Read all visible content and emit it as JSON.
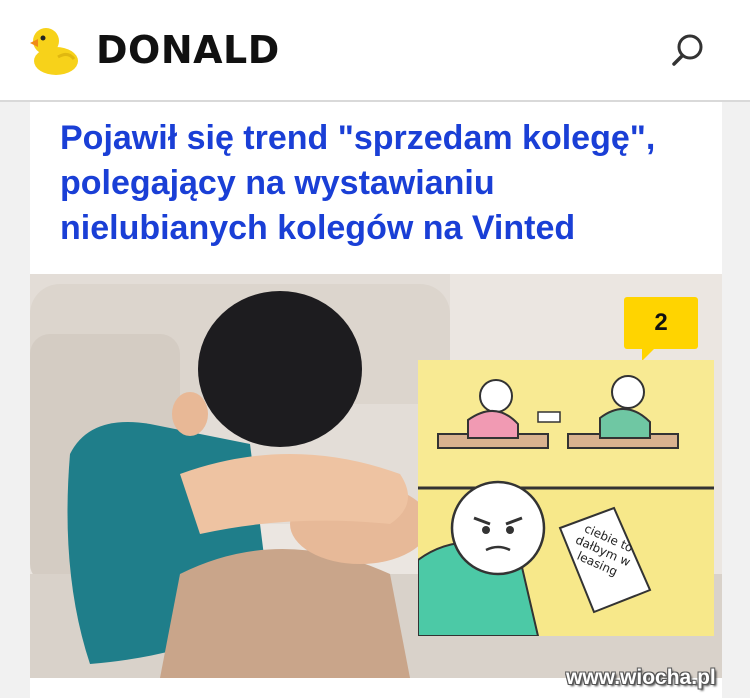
{
  "header": {
    "brand": "DONALD",
    "logo_icon": "duck-logo-icon",
    "search_icon": "search-icon"
  },
  "article": {
    "headline": "Pojawił się trend \"sprzedam kolegę\", polegający na wystawianiu nielubianych kolegów na Vinted",
    "comment_count": "2",
    "comic_note": "ciebie to dałbym w leasing",
    "watermark": "www.wiocha.pl"
  },
  "colors": {
    "headline": "#1a3fd6",
    "badge": "#ffd400",
    "comic_bg": "#f7e88a"
  }
}
